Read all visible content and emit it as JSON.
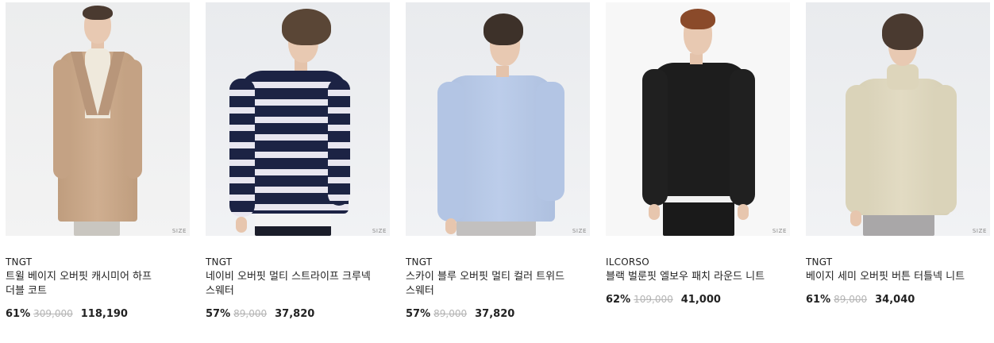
{
  "products": [
    {
      "brand": "TNGT",
      "name": "트윌 베이지 오버핏 캐시미어 하프 더블 코트",
      "discount": "61%",
      "original_price": "309,000",
      "price": "118,190",
      "size_label": "SIZE",
      "garment_color": "#c9a98a"
    },
    {
      "brand": "TNGT",
      "name": "네이비 오버핏 멀티 스트라이프 크루넥 스웨터",
      "discount": "57%",
      "original_price": "89,000",
      "price": "37,820",
      "size_label": "SIZE",
      "garment_color": "#1c2344"
    },
    {
      "brand": "TNGT",
      "name": "스카이 블루 오버핏 멀티 컬러 트위드 스웨터",
      "discount": "57%",
      "original_price": "89,000",
      "price": "37,820",
      "size_label": "SIZE",
      "garment_color": "#b7c8e6"
    },
    {
      "brand": "ILCORSO",
      "name": "블랙 벌룬핏 엘보우 패치 라운드 니트",
      "discount": "62%",
      "original_price": "109,000",
      "price": "41,000",
      "size_label": "SIZE",
      "garment_color": "#1b1b1b"
    },
    {
      "brand": "TNGT",
      "name": "베이지 세미 오버핏 버튼 터틀넥 니트",
      "discount": "61%",
      "original_price": "89,000",
      "price": "34,040",
      "size_label": "SIZE",
      "garment_color": "#ddd6bd"
    }
  ]
}
